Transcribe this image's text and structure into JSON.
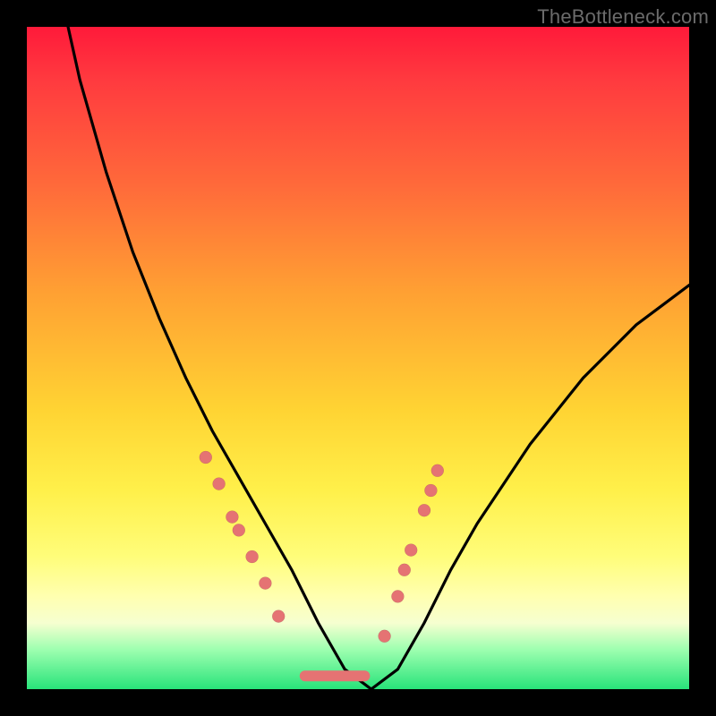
{
  "watermark": "TheBottleneck.com",
  "colors": {
    "curve": "#000000",
    "dot": "#e57373",
    "gradient_top": "#ff1a3a",
    "gradient_bottom": "#28e37a"
  },
  "chart_data": {
    "type": "line",
    "title": "",
    "xlabel": "",
    "ylabel": "",
    "xlim": [
      0,
      100
    ],
    "ylim": [
      0,
      100
    ],
    "x": [
      0,
      4,
      8,
      12,
      16,
      20,
      24,
      28,
      32,
      36,
      40,
      44,
      48,
      52,
      56,
      60,
      64,
      68,
      72,
      76,
      80,
      84,
      88,
      92,
      96,
      100
    ],
    "values": [
      132,
      110,
      92,
      78,
      66,
      56,
      47,
      39,
      32,
      25,
      18,
      10,
      3,
      0,
      3,
      10,
      18,
      25,
      31,
      37,
      42,
      47,
      51,
      55,
      58,
      61
    ],
    "annotations": {
      "left_cluster_x": [
        27,
        29,
        31,
        32,
        34,
        36,
        38
      ],
      "left_cluster_y": [
        35,
        31,
        26,
        24,
        20,
        16,
        11
      ],
      "right_cluster_x": [
        54,
        56,
        57,
        58,
        60,
        61,
        62
      ],
      "right_cluster_y": [
        8,
        14,
        18,
        21,
        27,
        30,
        33
      ],
      "flat_bottom_x": [
        42,
        51
      ],
      "flat_bottom_y": 2
    }
  }
}
